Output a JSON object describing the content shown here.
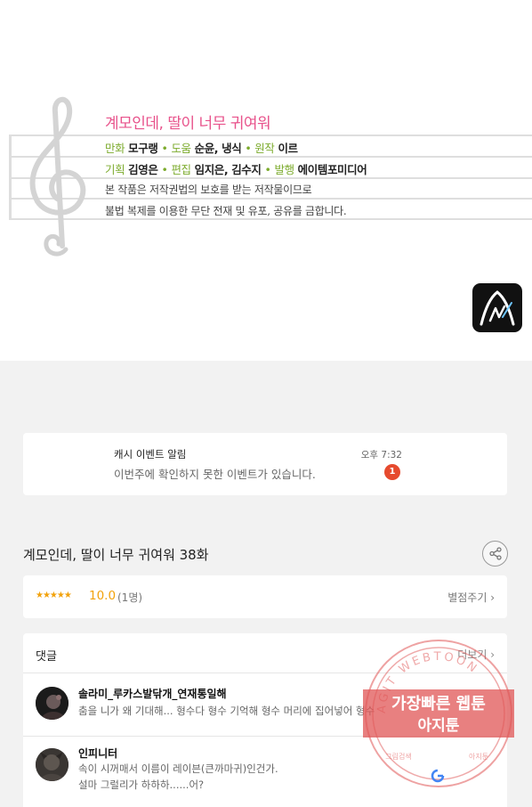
{
  "credits": {
    "title": "계모인데, 딸이 너무 귀여워",
    "row1": [
      {
        "role": "만화",
        "name": "모구랭"
      },
      {
        "role": "도움",
        "name": "순윤, 냉식"
      },
      {
        "role": "원작",
        "name": "이르"
      }
    ],
    "row2": [
      {
        "role": "기획",
        "name": "김영은"
      },
      {
        "role": "편집",
        "name": "임지은, 김수지"
      },
      {
        "role": "발행",
        "name": "에이템포미디어"
      }
    ],
    "notice_line1": "본 작품은 저작권법의 보호를 받는 저작물이므로",
    "notice_line2": "불법 복제를 이용한 무단 전재 및 유포, 공유를 금합니다.",
    "separator": "•"
  },
  "event": {
    "title": "캐시 이벤트 알림",
    "message": "이번주에 확인하지 못한 이벤트가 있습니다.",
    "time": "오후 7:32",
    "badge": "1"
  },
  "episode": {
    "title": "계모인데, 딸이 너무 귀여워 38화"
  },
  "rating": {
    "stars": "★★★★★",
    "score": "10.0",
    "count": "(1명)",
    "rate_label": "별점주기 ›"
  },
  "comments": {
    "title": "댓글",
    "more_label": "더보기 ›",
    "items": [
      {
        "author": "솔라미_루카스발닦개_연재통일해",
        "lines": [
          "춤을 니가 왜 기대해... 형수다 형수 기억해 형수 머리에 집어넣어 형수"
        ]
      },
      {
        "author": "인피니터",
        "lines": [
          "속이 시꺼매서 이름이 레이븐(큰까마귀)인건가.",
          "설마 그럴리가 하하하......어?"
        ]
      }
    ]
  },
  "watermark": {
    "ring_text": "AGIT WEBTOON",
    "main_text_line1": "가장빠른 웹툰",
    "main_text_line2": "아지툰",
    "bottom_left": "그림검색",
    "bottom_right": "아지툰"
  },
  "colors": {
    "title_pink": "#e8528b",
    "role_green": "#7cab2c",
    "star_orange": "#f2a20b",
    "badge_red": "#e64a2e",
    "stamp_red": "#e05555"
  },
  "icons": {
    "clef": "treble-clef-icon",
    "logo": "app-logo-icon",
    "share": "share-icon",
    "chevron": "chevron-right-icon"
  }
}
